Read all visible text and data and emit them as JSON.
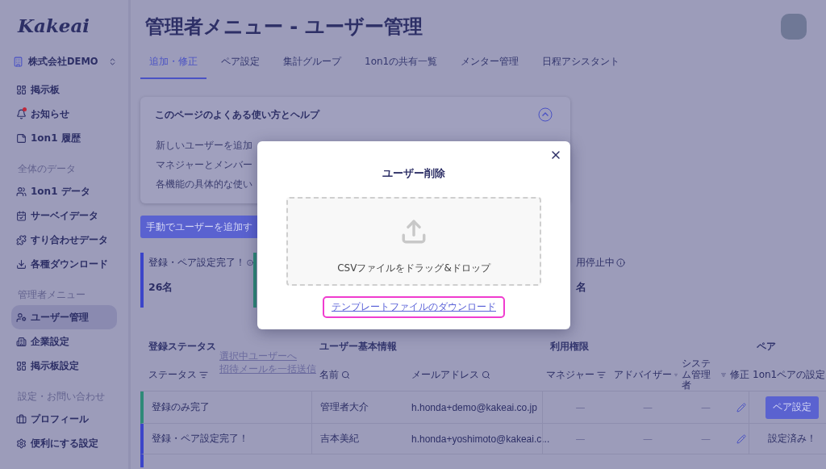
{
  "logo": "Kakeai",
  "company": {
    "name": "株式会社DEMO"
  },
  "sidebar": {
    "sections": [
      {
        "items": [
          {
            "label": "掲示板",
            "selected": false,
            "notification": false
          },
          {
            "label": "お知らせ",
            "selected": false,
            "notification": true
          },
          {
            "label": "1on1 履歴",
            "selected": false,
            "notification": false
          }
        ]
      },
      {
        "heading": "全体のデータ",
        "items": [
          {
            "label": "1on1 データ",
            "selected": false,
            "notification": false
          },
          {
            "label": "サーベイデータ",
            "selected": false,
            "notification": false
          },
          {
            "label": "すり合わせデータ",
            "selected": false,
            "notification": false
          },
          {
            "label": "各種ダウンロード",
            "selected": false,
            "notification": false
          }
        ]
      },
      {
        "heading": "管理者メニュー",
        "items": [
          {
            "label": "ユーザー管理",
            "selected": true,
            "notification": false
          },
          {
            "label": "企業設定",
            "selected": false,
            "notification": false
          },
          {
            "label": "掲示板設定",
            "selected": false,
            "notification": false
          }
        ]
      },
      {
        "heading": "設定・お問い合わせ",
        "items": [
          {
            "label": "プロフィール",
            "selected": false,
            "notification": false
          },
          {
            "label": "便利にする設定",
            "selected": false,
            "notification": false
          }
        ]
      }
    ]
  },
  "page_title": "管理者メニュー - ユーザー管理",
  "tabs": [
    {
      "label": "追加・修正",
      "selected": true
    },
    {
      "label": "ペア設定",
      "selected": false
    },
    {
      "label": "集計グループ",
      "selected": false
    },
    {
      "label": "1on1の共有一覧",
      "selected": false
    },
    {
      "label": "メンター管理",
      "selected": false
    },
    {
      "label": "日程アシスタント",
      "selected": false
    }
  ],
  "help": {
    "title": "このページのよくある使い方とヘルプ",
    "expanded": true,
    "items": [
      "新しいユーザーを追加",
      "マネジャーとメンバー",
      "各機能の具体的な使い"
    ]
  },
  "add_button": "手動でユーザーを追加す",
  "stats": [
    {
      "label": "登録・ペア設定完了！",
      "info": true,
      "value": "26名",
      "color": "#3b45c9"
    },
    {
      "color": "#2f8a78"
    },
    {
      "label": "用停止中",
      "info": true,
      "value": "名"
    }
  ],
  "bulk_action": {
    "lines": [
      "選択中ユーザーへ",
      "招待メールを一括送信"
    ],
    "disabled": true
  },
  "table": {
    "groups": [
      "登録ステータス",
      "ユーザー基本情報",
      "利用権限",
      "ペア"
    ],
    "columns": [
      {
        "label": "ステータス",
        "kind": "filter"
      },
      {
        "label": "名前",
        "kind": "search"
      },
      {
        "label": "メールアドレス",
        "kind": "search"
      },
      {
        "label": "マネジャー",
        "kind": "filter"
      },
      {
        "label": "アドバイザー",
        "kind": "filter"
      },
      {
        "label": "システム管理者",
        "kind": "filter"
      },
      {
        "label": "修正",
        "kind": "plain"
      },
      {
        "label": "1on1ペアの設定",
        "kind": "plain"
      }
    ],
    "rows": [
      {
        "status": "登録のみ完了",
        "color": "#2f8a78",
        "name": "管理者大介",
        "email": "h.honda+demo@kakeai.co.jp",
        "manager": "—",
        "advisor": "—",
        "sysadmin": "—",
        "pair": {
          "kind": "button",
          "label": "ペア設定"
        }
      },
      {
        "status": "登録・ペア設定完了！",
        "color": "#3b45c9",
        "name": "吉本美紀",
        "email": "h.honda+yoshimoto@kakeai.c...",
        "manager": "—",
        "advisor": "—",
        "sysadmin": "—",
        "pair": {
          "kind": "text",
          "label": "設定済み！"
        }
      },
      {
        "color": "#3b45c9"
      }
    ]
  },
  "modal": {
    "title": "ユーザー削除",
    "dropzone_text": "CSVファイルをドラッグ&ドロップ",
    "link": "テンプレートファイルのダウンロード",
    "link_highlighted": true
  }
}
